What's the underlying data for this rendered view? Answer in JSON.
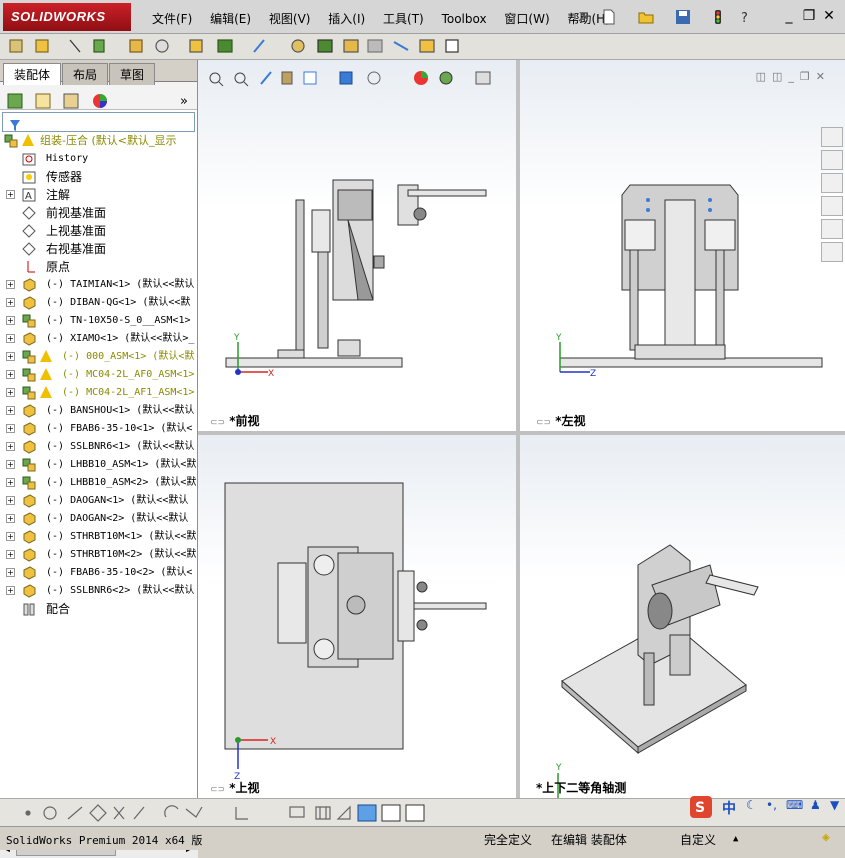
{
  "app": {
    "logo": "SOLIDWORKS"
  },
  "menu": [
    "文件(F)",
    "编辑(E)",
    "视图(V)",
    "插入(I)",
    "工具(T)",
    "Toolbox",
    "窗口(W)",
    "帮助(H)"
  ],
  "panel_tabs": [
    {
      "label": "装配体",
      "active": true
    },
    {
      "label": "布局",
      "active": false
    },
    {
      "label": "草图",
      "active": false
    }
  ],
  "tree": {
    "root": "组装-压合  (默认<默认_显示",
    "items": [
      {
        "label": "History",
        "kind": "history"
      },
      {
        "label": "传感器",
        "kind": "sensor"
      },
      {
        "label": "注解",
        "kind": "annotation",
        "expand": true
      },
      {
        "label": "前视基准面",
        "kind": "plane"
      },
      {
        "label": "上视基准面",
        "kind": "plane"
      },
      {
        "label": "右视基准面",
        "kind": "plane"
      },
      {
        "label": "原点",
        "kind": "origin"
      },
      {
        "label": "(-) TAIMIAN<1> (默认<<默认",
        "kind": "part",
        "expand": true
      },
      {
        "label": "(-) DIBAN-QG<1> (默认<<默",
        "kind": "part",
        "expand": true
      },
      {
        "label": "(-) TN-10X50-S_0__ASM<1>",
        "kind": "asm",
        "expand": true
      },
      {
        "label": "(-) XIAMO<1> (默认<<默认>_",
        "kind": "part",
        "expand": true
      },
      {
        "label": "(-) 000_ASM<1> (默认<默",
        "kind": "asm-warn",
        "expand": true
      },
      {
        "label": "(-) MC04-2L_AF0_ASM<1>",
        "kind": "asm-warn",
        "expand": true
      },
      {
        "label": "(-) MC04-2L_AF1_ASM<1>",
        "kind": "asm-warn",
        "expand": true
      },
      {
        "label": "(-) BANSHOU<1> (默认<<默认",
        "kind": "part",
        "expand": true
      },
      {
        "label": "(-) FBAB6-35-10<1> (默认<",
        "kind": "part",
        "expand": true
      },
      {
        "label": "(-) SSLBNR6<1> (默认<<默认",
        "kind": "part",
        "expand": true
      },
      {
        "label": "(-) LHBB10_ASM<1> (默认<默",
        "kind": "asm",
        "expand": true
      },
      {
        "label": "(-) LHBB10_ASM<2> (默认<默",
        "kind": "asm",
        "expand": true
      },
      {
        "label": "(-) DAOGAN<1> (默认<<默认",
        "kind": "part",
        "expand": true
      },
      {
        "label": "(-) DAOGAN<2> (默认<<默认",
        "kind": "part",
        "expand": true
      },
      {
        "label": "(-) STHRBT10M<1> (默认<<默",
        "kind": "part",
        "expand": true
      },
      {
        "label": "(-) STHRBT10M<2> (默认<<默",
        "kind": "part",
        "expand": true
      },
      {
        "label": "(-) FBAB6-35-10<2> (默认<",
        "kind": "part",
        "expand": true
      },
      {
        "label": "(-) SSLBNR6<2> (默认<<默认",
        "kind": "part",
        "expand": true
      },
      {
        "label": "配合",
        "kind": "mates"
      }
    ]
  },
  "viewports": {
    "front": "*前视",
    "left": "*左视",
    "top": "*上视",
    "iso": "*上下二等角轴测"
  },
  "status": {
    "app": "SolidWorks Premium 2014 x64 版",
    "defined": "完全定义",
    "mode": "在编辑 装配体",
    "custom": "自定义"
  },
  "ime": {
    "lang": "中"
  },
  "colors": {
    "brand": "#cc2027",
    "viewport_top": "#e8edf3",
    "warning": "#f0c000"
  }
}
